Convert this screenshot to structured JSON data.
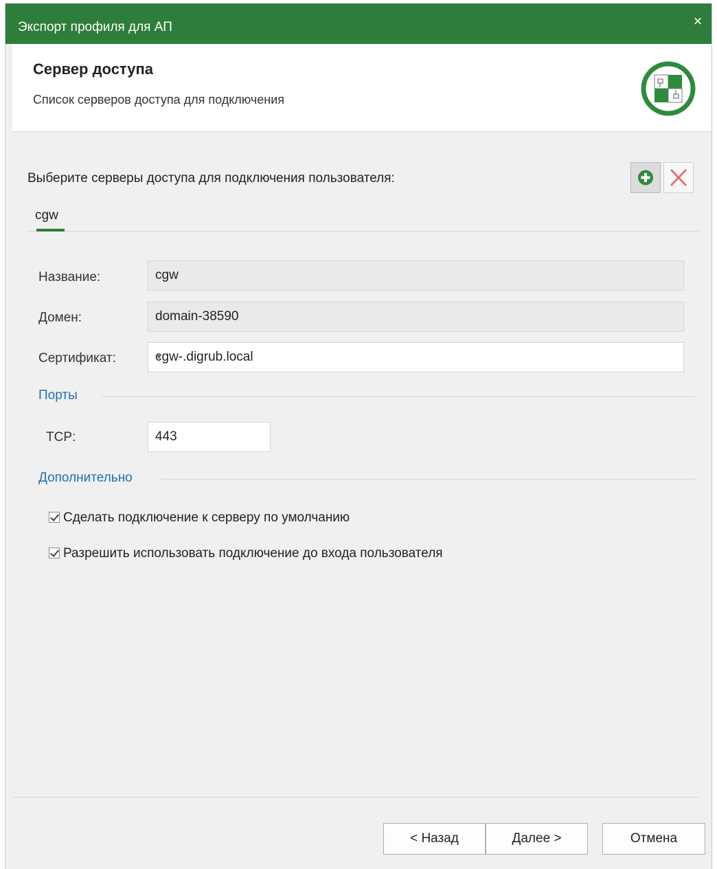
{
  "window": {
    "title": "Экспорт профиля для АП",
    "close": "×"
  },
  "header": {
    "title": "Сервер доступа",
    "subtitle": "Список серверов доступа для подключения"
  },
  "prompt": "Выберите серверы доступа для подключения пользователя:",
  "toolbar": {
    "add_icon": "add-icon",
    "delete_icon": "delete-icon"
  },
  "tabs": [
    {
      "label": "cgw",
      "active": true
    }
  ],
  "form": {
    "name": {
      "label": "Название:",
      "value": "cgw"
    },
    "domain": {
      "label": "Домен:",
      "value": "domain-38590"
    },
    "certificate": {
      "label": "Сертификат:",
      "value": "cgw-.digrub.local"
    }
  },
  "ports": {
    "section": "Порты",
    "tcp_label": "TCP:",
    "tcp_value": "443"
  },
  "advanced": {
    "section": "Дополнительно",
    "options": [
      {
        "label": "Сделать подключение к серверу по умолчанию",
        "checked": true
      },
      {
        "label": "Разрешить использовать подключение до входа пользователя",
        "checked": true
      }
    ]
  },
  "buttons": {
    "back": "< Назад",
    "next": "Далее >",
    "cancel": "Отмена"
  },
  "colors": {
    "accent": "#2e7d3a",
    "section": "#1f6fb5",
    "delete": "#e57373"
  }
}
